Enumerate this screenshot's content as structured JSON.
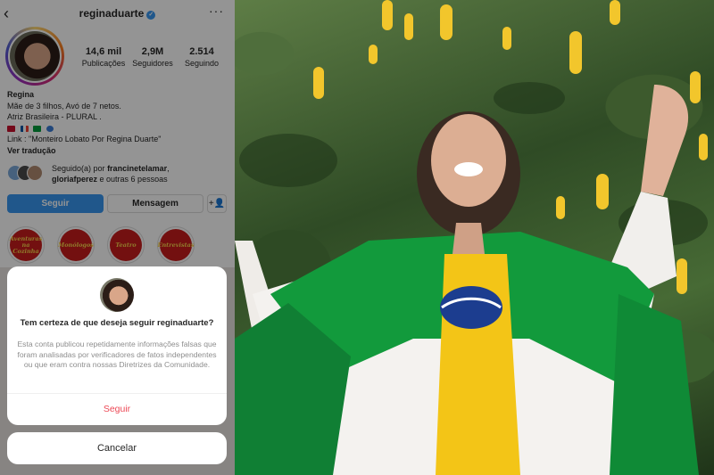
{
  "header": {
    "username": "reginaduarte",
    "back_glyph": "‹",
    "more_glyph": "···",
    "verified_glyph": "✓"
  },
  "stats": [
    {
      "value": "14,6 mil",
      "label": "Publicações"
    },
    {
      "value": "2,9M",
      "label": "Seguidores"
    },
    {
      "value": "2.514",
      "label": "Seguindo"
    }
  ],
  "bio": {
    "name": "Regina",
    "line1": "Mãe de 3 filhos, Avó de 7 netos.",
    "line2": "Atriz Brasileira - PLURAL .",
    "link": "Link : \"Monteiro Lobato Por Regina Duarte\"",
    "translate": "Ver tradução"
  },
  "followed_by": {
    "prefix": "Seguido(a) por",
    "user1": "francinetelamar",
    "user2": "gloriafperez",
    "suffix": "e outras 6 pessoas"
  },
  "actions": {
    "follow": "Seguir",
    "message": "Mensagem",
    "add_user_glyph": "+👤"
  },
  "highlights": [
    {
      "label": "Aventuras na Cozinha"
    },
    {
      "label": "Monólogos"
    },
    {
      "label": "Teatro"
    },
    {
      "label": "Entrevistas"
    }
  ],
  "dialog": {
    "title": "Tem certeza de que deseja seguir reginaduarte?",
    "body": "Esta conta publicou repetidamente informações falsas que foram analisadas por verificadores de fatos independentes ou que eram contra nossas Diretrizes da Comunidade.",
    "confirm": "Seguir",
    "cancel": "Cancelar"
  },
  "colors": {
    "accent_blue": "#3897f0",
    "destructive_red": "#ed4956",
    "highlight_red": "#c61d1d"
  }
}
